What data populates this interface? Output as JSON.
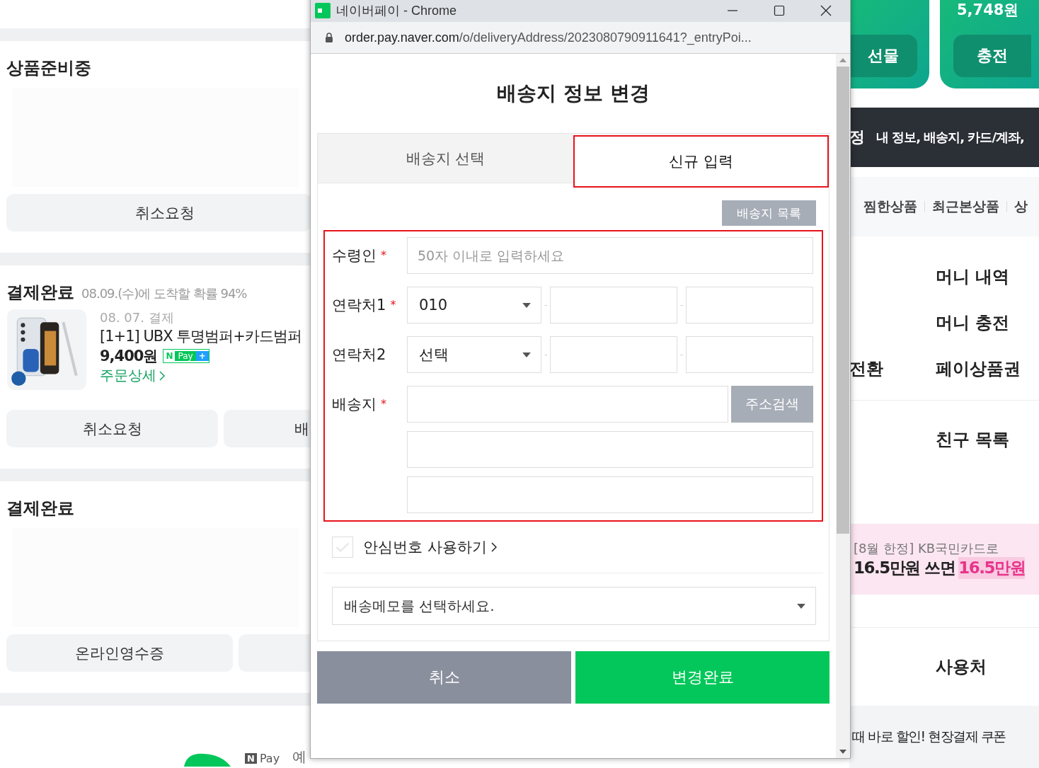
{
  "left_page": {
    "sections": [
      {
        "title": "상품준비중",
        "buttons": [
          "취소요청"
        ]
      },
      {
        "title": "결제완료",
        "note": "08.09.(수)에 도착할 확률 94%",
        "order": {
          "date": "08. 07. 결제",
          "name": "[1+1] UBX 투명범퍼+카드범퍼",
          "price": "9,400원",
          "badge": {
            "logo": "N",
            "label": "Pay",
            "plus": "+"
          },
          "link": "주문상세"
        },
        "buttons": [
          "취소요청",
          "배"
        ]
      },
      {
        "title": "결제완료",
        "buttons": [
          "온라인영수증"
        ]
      }
    ],
    "footer": {
      "logo": "N",
      "label": "Pay",
      "text": "예"
    }
  },
  "right_page": {
    "balance": "5,748원",
    "card_buttons": [
      "선물",
      "충전"
    ],
    "notice": {
      "lead": "정",
      "text": "내 정보, 배송지, 카드/계좌,"
    },
    "tabs": [
      "찜한상품",
      "최근본상품",
      "상"
    ],
    "menu": [
      {
        "right": "머니 내역"
      },
      {
        "right": "머니 충전"
      },
      {
        "left": "전환",
        "right": "페이상품권"
      }
    ],
    "friends": "친구 목록",
    "banner": {
      "caption": "[8월 한정] KB국민카드로",
      "headline": "16.5만원 쓰면",
      "highlight": "16.5만원"
    },
    "places": "사용처",
    "bottom": "때 바로 할인! 현장결제 쿠폰"
  },
  "window": {
    "title": "네이버페이 - Chrome",
    "url_host": "order.pay.naver.com",
    "url_path": "/o/deliveryAddress/2023080790911641?_entryPoi..."
  },
  "dialog": {
    "title": "배송지 정보 변경",
    "tabs": [
      {
        "label": "배송지 선택",
        "selected": false,
        "highlighted": false
      },
      {
        "label": "신규 입력",
        "selected": true,
        "highlighted": true
      }
    ],
    "list_button": "배송지 목록",
    "form_highlighted": true,
    "rows": [
      {
        "kind": "text",
        "label": "수령인",
        "required_mark": "*",
        "placeholder": "50자 이내로 입력하세요"
      },
      {
        "kind": "phone",
        "label": "연락처1",
        "required_mark": "*",
        "select": "010",
        "separator": "-"
      },
      {
        "kind": "phone",
        "label": "연락처2",
        "select": "선택",
        "separator": "-"
      },
      {
        "kind": "address",
        "label": "배송지",
        "required_mark": "*",
        "button": "주소검색"
      }
    ],
    "safe_number": {
      "label": "안심번호 사용하기",
      "checked": false
    },
    "memo": "배송메모를 선택하세요.",
    "buttons": [
      {
        "kind": "cancel",
        "label": "취소"
      },
      {
        "kind": "confirm",
        "label": "변경완료"
      }
    ]
  }
}
